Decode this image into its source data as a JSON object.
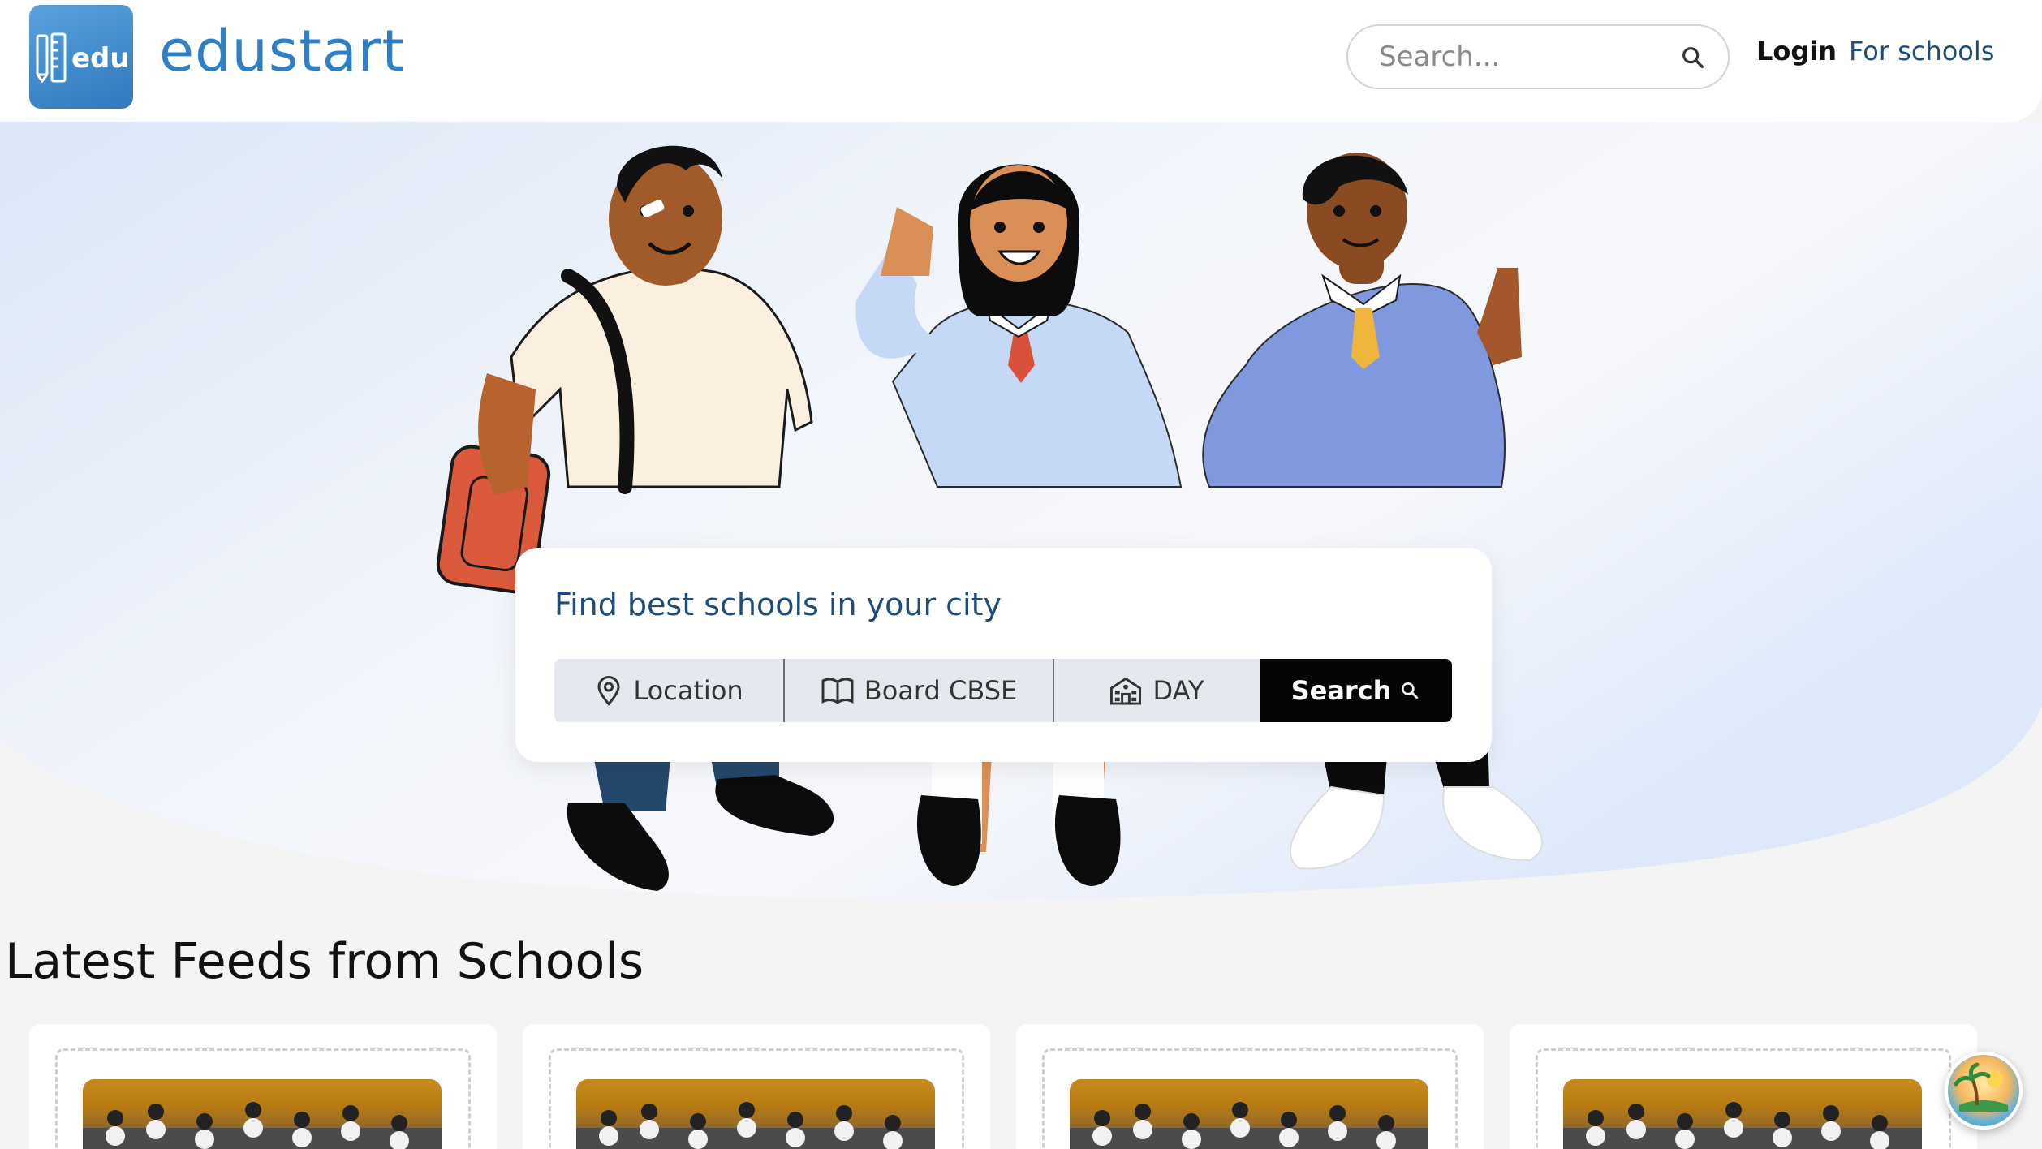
{
  "header": {
    "logo_text": "edu",
    "brand": "edustart",
    "search_placeholder": "Search...",
    "login": "Login",
    "for_schools": "For schools"
  },
  "hero": {
    "card_title": "Find best schools in your city",
    "filters": {
      "location": "Location",
      "board": "Board CBSE",
      "day": "DAY"
    },
    "search_button": "Search"
  },
  "feeds": {
    "title": "Latest Feeds from Schools"
  },
  "icons": {
    "search": "search-icon",
    "location": "map-pin-icon",
    "board": "book-icon",
    "day": "school-building-icon",
    "fab": "island-sun-icon"
  },
  "colors": {
    "brand": "#2f7fc6",
    "title_blue": "#1e4d7b",
    "button_black": "#050505",
    "filter_bg": "#e5e8ee"
  }
}
